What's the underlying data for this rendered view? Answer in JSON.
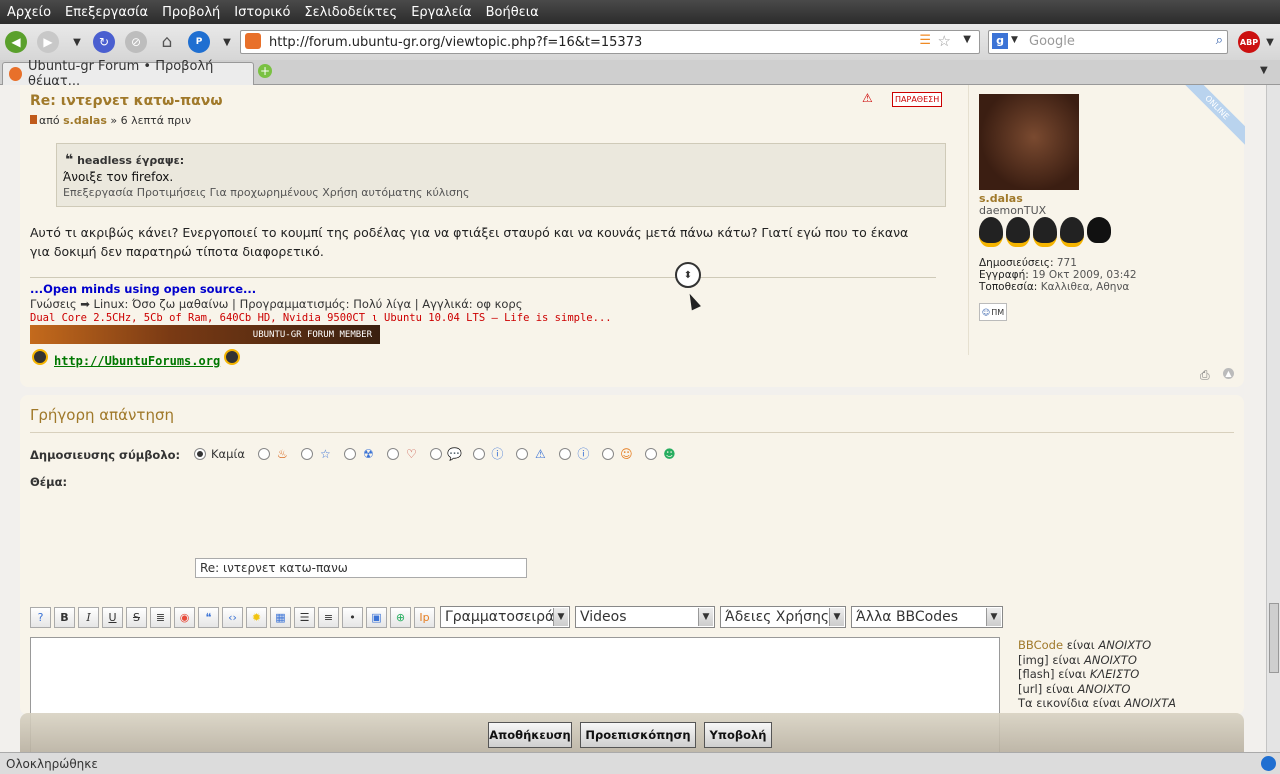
{
  "menu": [
    "Αρχείο",
    "Επεξεργασία",
    "Προβολή",
    "Ιστορικό",
    "Σελιδοδείκτες",
    "Εργαλεία",
    "Βοήθεια"
  ],
  "url": "http://forum.ubuntu-gr.org/viewtopic.php?f=16&t=15373",
  "search_placeholder": "Google",
  "adblock_label": "ABP",
  "tab_title": "Ubuntu-gr Forum • Προβολή θέματ...",
  "post": {
    "title": "Re: ιντερνετ κατω-πανω",
    "by_prefix": "από",
    "author": "s.dalas",
    "time": "» 6 λεπτά πριν",
    "quote_button": "ΠΑΡΑΘΕΣΗ",
    "quote_header": "headless έγραψε:",
    "quote_text": "Άνοιξε τον firefox.",
    "quote_text_cut": "Επεξεργασία Προτιμήσεις Για προχωρημένους Χρήση αυτόματης κύλισης",
    "body": "Αυτό τι ακριβώς κάνει? Ενεργοποιεί το κουμπί της ροδέλας για να φτιάξει σταυρό και να κουνάς μετά πάνω κάτω? Γιατί εγώ που το έκανα για δοκιμή δεν παρατηρώ τίποτα διαφορετικό.",
    "sig_line1": "...Open minds using open source...",
    "sig_line2": "Γνώσεις ➡ Linux: Όσο ζω μαθαίνω | Προγραμματισμός: Πολύ λίγα | Αγγλικά: οφ κορς",
    "sig_line3": "Dual Core 2.5CHz, 5Cb of Ram, 640Cb HD, Nvidia 9500CT ι Ubuntu 10.04 LTS — Life is simple...",
    "banner_text": "UBUNTU-GR FORUM MEMBER",
    "ubuntuforums_link": "http://UbuntuForums.org"
  },
  "profile": {
    "online_label": "ONLINE",
    "name": "s.dalas",
    "rank": "daemonTUX",
    "posts_label": "Δημοσιεύσεις:",
    "posts_value": "771",
    "joined_label": "Εγγραφή:",
    "joined_value": "19 Οκτ 2009, 03:42",
    "location_label": "Τοποθεσία:",
    "location_value": "Καλλιθεα, Αθηνα",
    "pm_label": "ΠΜ"
  },
  "quick_reply": {
    "title": "Γρήγορη απάντηση",
    "icon_label": "Δημοσιευσης σύμβολο:",
    "icon_none": "Καμία",
    "subject_label": "Θέμα:",
    "subject_value": "Re: ιντερνετ κατω-πανω",
    "font_select": "Γραμματοσειρά",
    "videos_select": "Videos",
    "licenses_select": "Άδειες Χρήσης",
    "other_select": "Άλλα BBCodes",
    "bbcode_link": "BBCode",
    "bb_is": "είναι",
    "bb_on": "ΑΝΟΙΧΤΟ",
    "img_label": "[img]",
    "flash_label": "[flash]",
    "flash_state": "ΚΛΕΙΣΤΟ",
    "url_label": "[url]",
    "smilies_label": "Τα εικονίδια",
    "smilies_state": "ΑΝΟΙΧΤΑ",
    "save_button": "Αποθήκευση",
    "preview_button": "Προεπισκόπηση",
    "submit_button": "Υποβολή"
  },
  "status": "Ολοκληρώθηκε"
}
